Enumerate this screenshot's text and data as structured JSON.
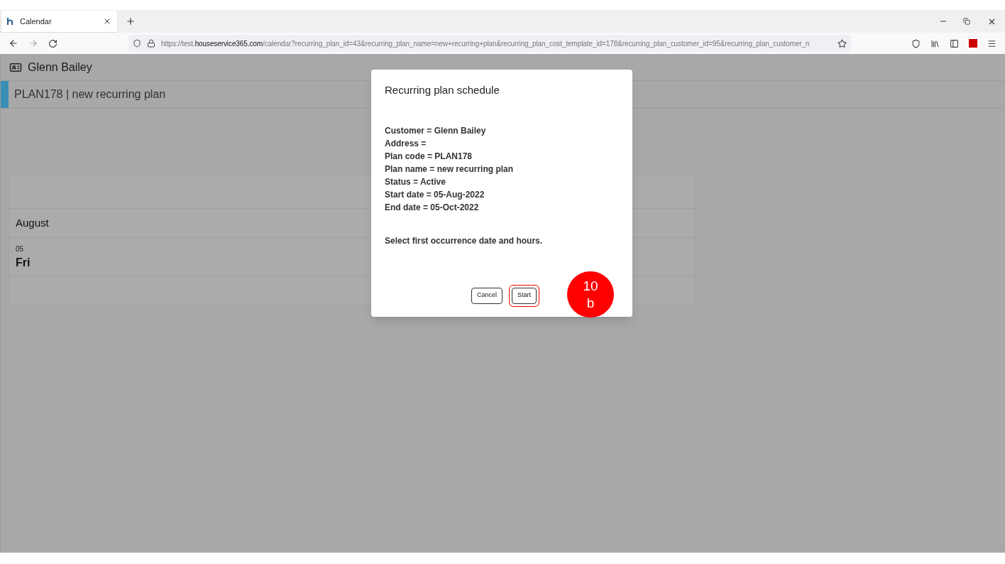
{
  "browser": {
    "tab_title": "Calendar",
    "url": {
      "scheme": "https://test.",
      "host": "houseservice365.com",
      "path": "/calendar?recurring_plan_id=43&recurring_plan_name=new+recurring+plan&recurring_plan_cost_template_id=178&recurring_plan_customer_id=95&recurring_plan_customer_n"
    }
  },
  "page": {
    "customer_name": "Glenn Bailey",
    "plan_title": "PLAN178 | new recurring plan"
  },
  "calendar": {
    "month": "August",
    "day_number": "05",
    "weekday": "Fri"
  },
  "dialog": {
    "title": "Recurring plan schedule",
    "lines": [
      "Customer = Glenn Bailey",
      "Address =",
      "Plan code = PLAN178",
      "Plan name = new recurring plan",
      "Status = Active",
      "Start date = 05-Aug-2022",
      "End date = 05-Oct-2022"
    ],
    "prompt": "Select first occurrence date and hours.",
    "buttons": [
      {
        "label": "Cancel",
        "highlighted": false
      },
      {
        "label": "Start",
        "highlighted": true
      }
    ]
  },
  "callout": {
    "lines": [
      "10",
      "b"
    ]
  }
}
